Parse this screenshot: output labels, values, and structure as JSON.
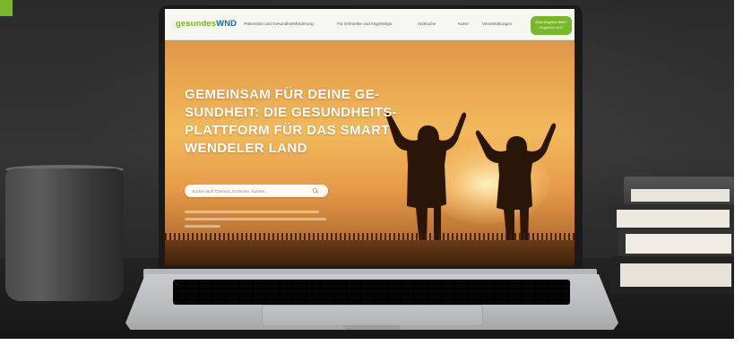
{
  "site": {
    "logo_part1": "gesundes",
    "logo_part2": "WND",
    "nav": [
      "Prävention und Gesundheitsförderung",
      "Für Erkrankte und Angehörige",
      "Arztsuche",
      "Kurse",
      "Veranstaltungen"
    ],
    "cta_label": "Dein Angebot fehlt?",
    "cta_sub": "Registriere dich!",
    "headline_lines": [
      "GEMEINSAM FÜR DEINE GE-",
      "SUNDHEIT: DIE GESUNDHEITS-",
      "PLATTFORM FÜR DAS SMART",
      "WENDELER LAND"
    ],
    "search_placeholder": "Suche nach Themen, Arztinnen, Kursen..."
  },
  "colors": {
    "brand_green": "#78b82a",
    "brand_blue": "#1c6e8c"
  },
  "icons": {
    "search": "search-icon"
  }
}
